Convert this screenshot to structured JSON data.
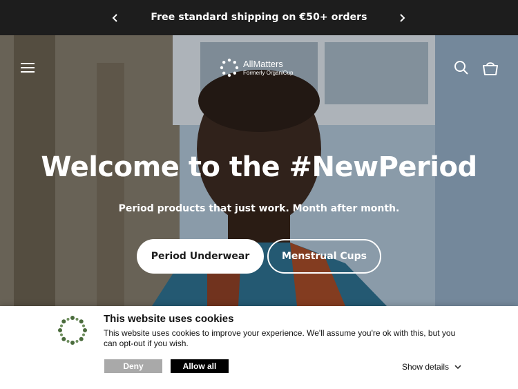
{
  "announcement": {
    "text": "Free standard shipping on €50+ orders",
    "prev_icon": "chevron-left-icon",
    "next_icon": "chevron-right-icon"
  },
  "header": {
    "logo_name": "AllMatters",
    "logo_tagline": "Formerly OrganiCup",
    "menu_icon": "hamburger-menu-icon",
    "search_icon": "search-icon",
    "cart_icon": "cart-icon"
  },
  "hero": {
    "title": "Welcome to the #NewPeriod",
    "subtitle": "Period products that just work. Month after month.",
    "primary_button": "Period Underwear",
    "secondary_button": "Menstrual Cups"
  },
  "cookie_banner": {
    "title": "This website uses cookies",
    "body": "This website uses cookies to improve your experience. We'll assume you're ok with this, but you can opt-out if you wish.",
    "deny_label": "Deny",
    "allow_label": "Allow all",
    "details_label": "Show details",
    "icon_color": "#4a6b3c"
  },
  "colors": {
    "announcement_bg": "#1d1d1d",
    "deny_bg": "#a9a9a9",
    "allow_bg": "#000000"
  }
}
